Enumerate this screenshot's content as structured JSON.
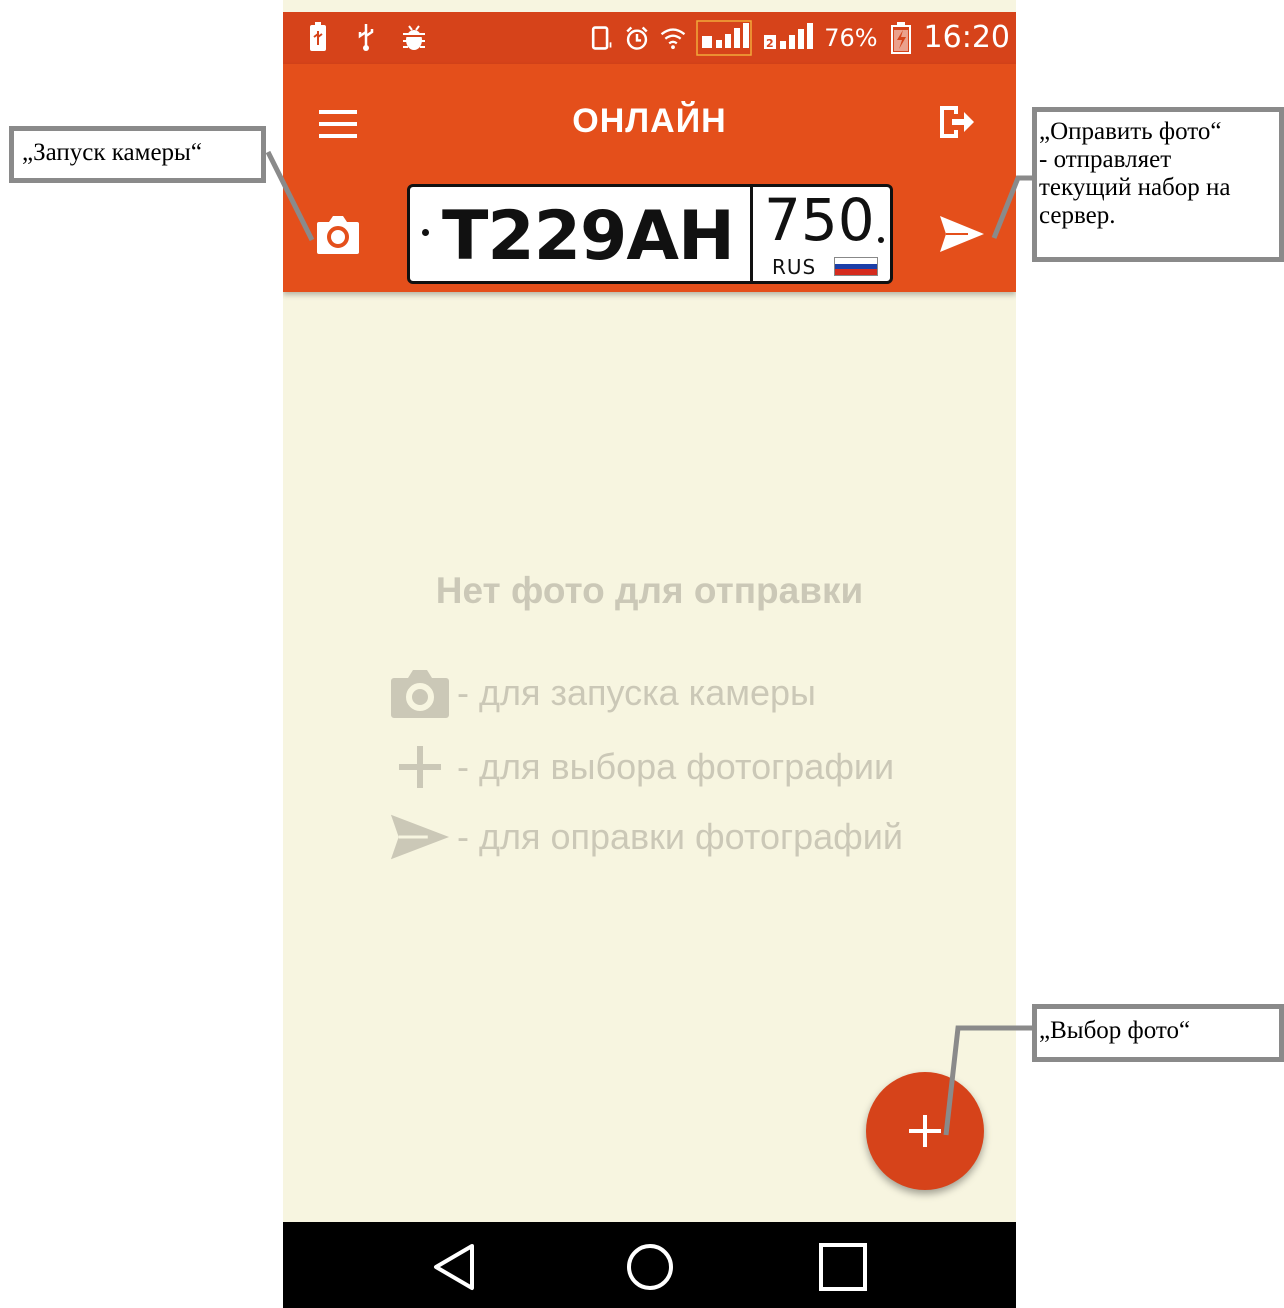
{
  "status_bar": {
    "battery_percent": "76%",
    "time": "16:20",
    "icons": [
      "usb-charge-icon",
      "usb-icon",
      "debug-icon",
      "vibrate-icon",
      "alarm-icon",
      "wifi-icon",
      "signal-sim1-icon",
      "signal-sim2-icon",
      "battery-charging-icon"
    ]
  },
  "app_bar": {
    "title": "ОНЛАЙН",
    "plate": {
      "number": "Т229АН",
      "region": "750",
      "country": "RUS"
    }
  },
  "empty_state": {
    "title": "Нет фото для отправки",
    "hints": [
      {
        "icon": "camera-icon",
        "text": "- для запуска камеры"
      },
      {
        "icon": "plus-icon",
        "text": "- для выбора фотографии"
      },
      {
        "icon": "send-icon",
        "text": "- для оправки фотографий"
      }
    ]
  },
  "callouts": {
    "camera": "„Запуск камеры“",
    "send_title": "„Оправить фото“",
    "send_line2": "- отправляет",
    "send_line3": "текущий набор на",
    "send_line4": "сервер.",
    "pick": "„Выбор фото“"
  },
  "colors": {
    "accent": "#e44f1b",
    "status_bar": "#d6431a",
    "fab": "#d6431a",
    "background": "#f7f5e0",
    "hint_text": "#cbc8b7"
  }
}
